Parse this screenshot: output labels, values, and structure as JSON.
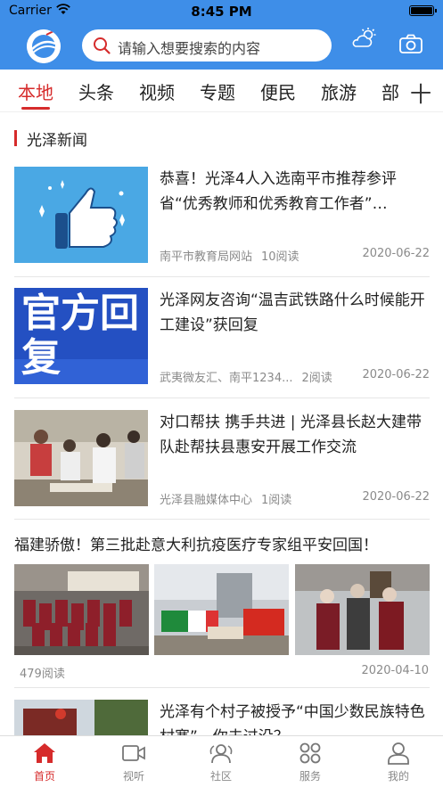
{
  "status": {
    "carrier": "Carrier",
    "time": "8:45 PM"
  },
  "header": {
    "search_placeholder": "请输入想要搜索的内容",
    "icons": [
      "app-logo-icon",
      "search-icon",
      "weather-icon",
      "camera-icon"
    ]
  },
  "tabs": [
    {
      "label": "本地",
      "active": true
    },
    {
      "label": "头条"
    },
    {
      "label": "视频"
    },
    {
      "label": "专题"
    },
    {
      "label": "便民"
    },
    {
      "label": "旅游"
    },
    {
      "label": "部"
    }
  ],
  "tabs_more": "十",
  "section_title": "光泽新闻",
  "news": [
    {
      "headline": "恭喜！光泽4人入选南平市推荐参评省“优秀教师和优秀教育工作者”…",
      "source": "南平市教育局网站",
      "reads": "10阅读",
      "date": "2020-06-22",
      "thumb": "thumbs-up-icon"
    },
    {
      "headline": "光泽网友咨询“温吉武铁路什么时候能开工建设”获回复",
      "source": "武夷微友汇、南平1234...",
      "reads": "2阅读",
      "date": "2020-06-22",
      "thumb_text": "官方回复"
    },
    {
      "headline": "对口帮扶 携手共进 | 光泽县长赵大建带队赴帮扶县惠安开展工作交流",
      "source": "光泽县融媒体中心",
      "reads": "1阅读",
      "date": "2020-06-22",
      "thumb": "photo-meeting"
    }
  ],
  "gallery_news": {
    "headline": "福建骄傲！第三批赴意大利抗疫医疗专家组平安回国！",
    "reads": "479阅读",
    "date": "2020-04-10"
  },
  "partial_news": {
    "headline": "光泽有个村子被授予“中国少数民族特色村寨”，你去过没？"
  },
  "bottom_nav": [
    {
      "label": "首页",
      "icon": "home-icon",
      "active": true
    },
    {
      "label": "视听",
      "icon": "video-icon"
    },
    {
      "label": "社区",
      "icon": "community-icon"
    },
    {
      "label": "服务",
      "icon": "grid-icon"
    },
    {
      "label": "我的",
      "icon": "user-icon"
    }
  ],
  "colors": {
    "brand_blue": "#3e8ee8",
    "accent_red": "#d62b2b",
    "meta_gray": "#8a8a8a"
  }
}
